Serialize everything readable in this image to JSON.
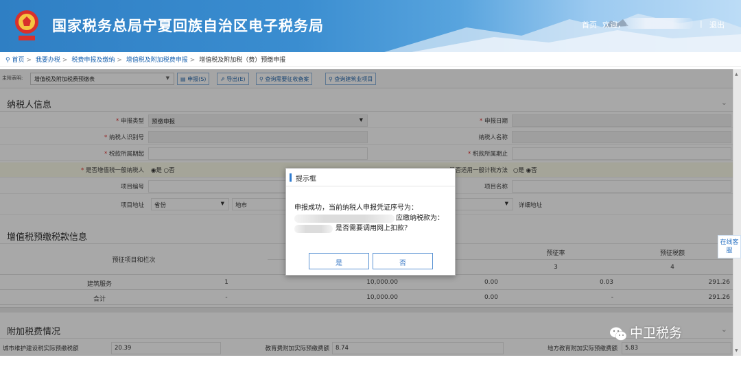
{
  "header": {
    "site_title": "国家税务总局宁夏回族自治区电子税务局",
    "home_link": "首页",
    "welcome": "欢迎，",
    "separator": "|",
    "logout": "退出",
    "emblem_icon": "tax-emblem-icon",
    "colors": {
      "brand_blue": "#2f7fc4",
      "accent": "#2e7bd0"
    }
  },
  "breadcrumb": {
    "pin_icon": "location-pin-icon",
    "items": [
      "首页",
      "我要办税",
      "税费申报及缴纳",
      "增值税及附加税费申报",
      "增值税及附加税（费）预缴申报"
    ],
    "sep": ">"
  },
  "toolbar": {
    "label": "主附表明:",
    "selected": "增值税及附加税费预缴表",
    "buttons": [
      "申报(S)",
      "导出(E)",
      "查询需要征收备案",
      "查询建筑业项目"
    ]
  },
  "taxpayer_section": {
    "title": "纳税人信息",
    "fields": {
      "declare_type_label": "申报类型",
      "declare_type_value": "预缴申报",
      "declare_date_label": "申报日期",
      "taxpayer_id_label": "纳税人识别号",
      "taxpayer_name_label": "纳税人名称",
      "period_start_label": "税款所属期起",
      "period_end_label": "税款所属期止",
      "general_taxpayer_label": "是否增值税一般纳税人",
      "yes": "是",
      "no": "否",
      "simple_method_label": "是否适用一般计税方法",
      "project_no_label": "项目编号",
      "project_name_label": "项目名称",
      "project_addr_label": "项目地址",
      "province": "省份",
      "city": "地市",
      "detail_addr_label": "详细地址"
    }
  },
  "vat_section": {
    "title": "增值税预缴税款信息",
    "columns": [
      "预征项目和栏次",
      "预征率",
      "预征税额"
    ],
    "column_nums": [
      "3",
      "4"
    ],
    "rows": [
      {
        "item": "建筑服务",
        "no": "1",
        "sales": "10,000.00",
        "deduct": "0.00",
        "rate": "0.03",
        "tax": "291.26"
      },
      {
        "item": "合计",
        "no": "-",
        "sales": "10,000.00",
        "deduct": "0.00",
        "rate": "-",
        "tax": "291.26"
      }
    ]
  },
  "surtax_section": {
    "title": "附加税费情况",
    "city_label": "城市维护建设税实际预缴税额",
    "city_value": "20.39",
    "edu_label": "教育费附加实际预缴费额",
    "edu_value": "8.74",
    "local_edu_label": "地方教育附加实际预缴费额",
    "local_edu_value": "5.83"
  },
  "dialog": {
    "title": "提示框",
    "line1": "申报成功，当前纳税人申报凭证序号为：",
    "line2_suffix": "应缴纳税款为：",
    "line3_suffix": "是否需要调用网上扣款？",
    "yes_button": "是",
    "no_button": "否"
  },
  "online_service": "在线客服",
  "watermark": "中卫税务"
}
